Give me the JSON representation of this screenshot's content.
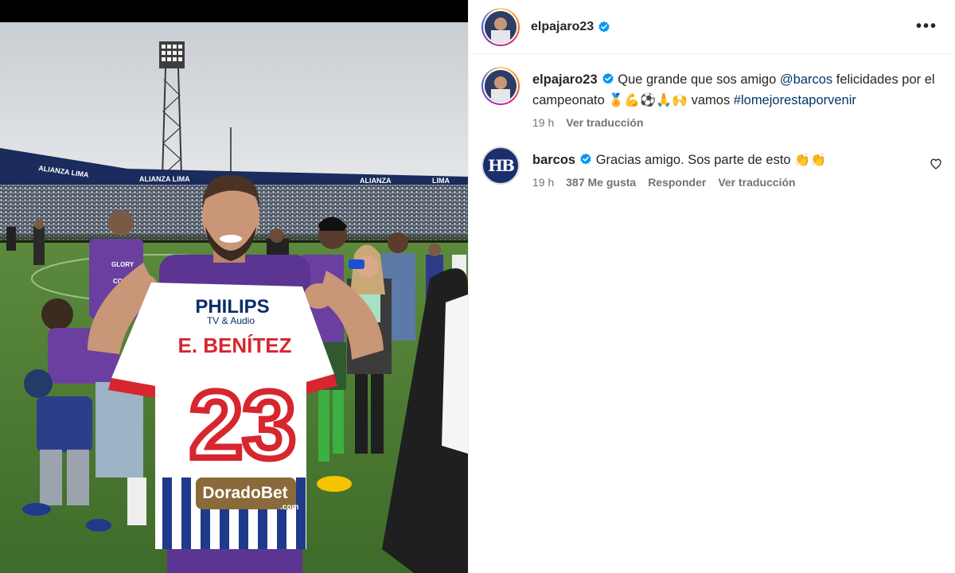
{
  "post": {
    "author": "elpajaro23",
    "more_label": "•••",
    "photo": {
      "banner_left": "ALIANZA LIMA",
      "banner_mid": "ALIANZA LIMA",
      "banner_right1": "ALIANZA",
      "banner_right2": "LIMA",
      "jersey_sponsor": "PHILIPS",
      "jersey_sponsor_sub": "TV & Audio",
      "jersey_name": "E. BENÍTEZ",
      "jersey_number": "23",
      "jersey_bottom_sponsor": "DoradoBet",
      "jersey_bottom_sponsor_sub": ".com",
      "tshirt_text1": "GLORY",
      "tshirt_text2": "CON"
    }
  },
  "comments": [
    {
      "username": "elpajaro23",
      "text_before": "Que grande que sos amigo ",
      "mention": "@barcos",
      "text_mid": " felicidades por el campeonato ",
      "emojis": "🏅💪⚽🙏🙌",
      "text_after": " vamos ",
      "hashtag": "#lomejorestaporvenir",
      "time": "19 h",
      "translate": "Ver traducción"
    },
    {
      "username": "barcos",
      "avatar_text": "HB",
      "text": "Gracias amigo. Sos parte de esto ",
      "emojis": "👏👏",
      "time": "19 h",
      "likes": "387 Me gusta",
      "reply": "Responder",
      "translate": "Ver traducción"
    }
  ],
  "colors": {
    "verified": "#0095f6",
    "link": "#00376b",
    "meta": "#737373",
    "alianza_blue": "#1f3a8a",
    "purple_shirt": "#6b3fa0",
    "jersey_red": "#d7262e"
  },
  "icons": [
    "verified-icon",
    "more-options-icon",
    "heart-icon"
  ]
}
